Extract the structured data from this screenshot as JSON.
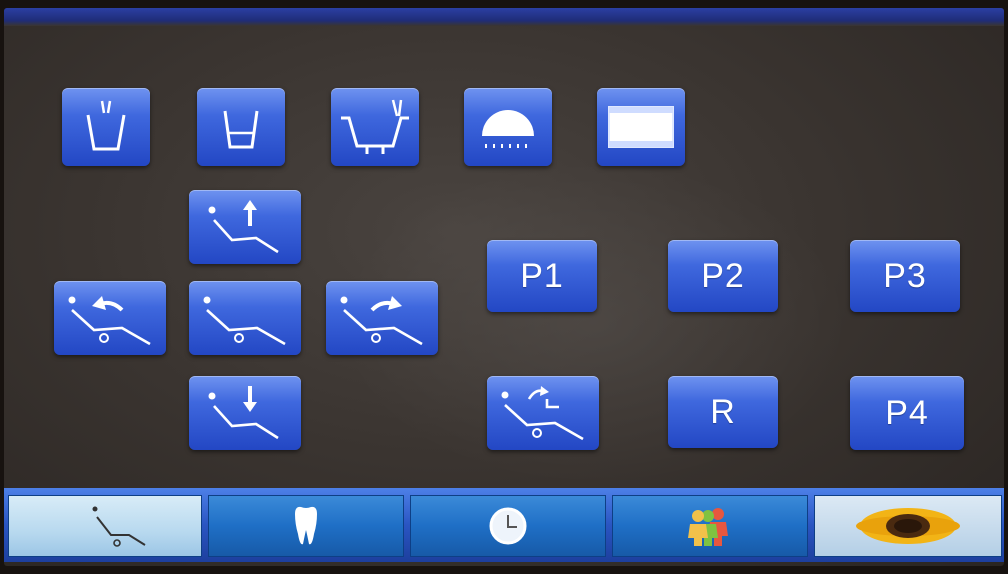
{
  "preset_buttons": {
    "p1": "P1",
    "p2": "P2",
    "p3": "P3",
    "p4": "P4",
    "reset": "R"
  },
  "icons": {
    "cup_fill": "cup-fill-icon",
    "cup_water": "cup-water-icon",
    "bowl_rinse": "bowl-rinse-icon",
    "operating_light": "operating-light-icon",
    "film_viewer": "film-viewer-icon",
    "chair_up": "chair-up-icon",
    "chair_down": "chair-down-icon",
    "backrest_up": "backrest-up-icon",
    "backrest_down": "backrest-down-icon",
    "chair_home": "chair-home-icon",
    "chair_last_position": "chair-last-position-icon"
  },
  "bottom_tabs": [
    {
      "icon": "chair-tab-icon"
    },
    {
      "icon": "tooth-icon"
    },
    {
      "icon": "clock-icon"
    },
    {
      "icon": "users-icon"
    },
    {
      "icon": "sunflower-icon"
    }
  ],
  "colors": {
    "button_blue": "#2f58d6",
    "screen_background": "#3b3531",
    "bottom_bar_blue": "#2a55c2"
  }
}
